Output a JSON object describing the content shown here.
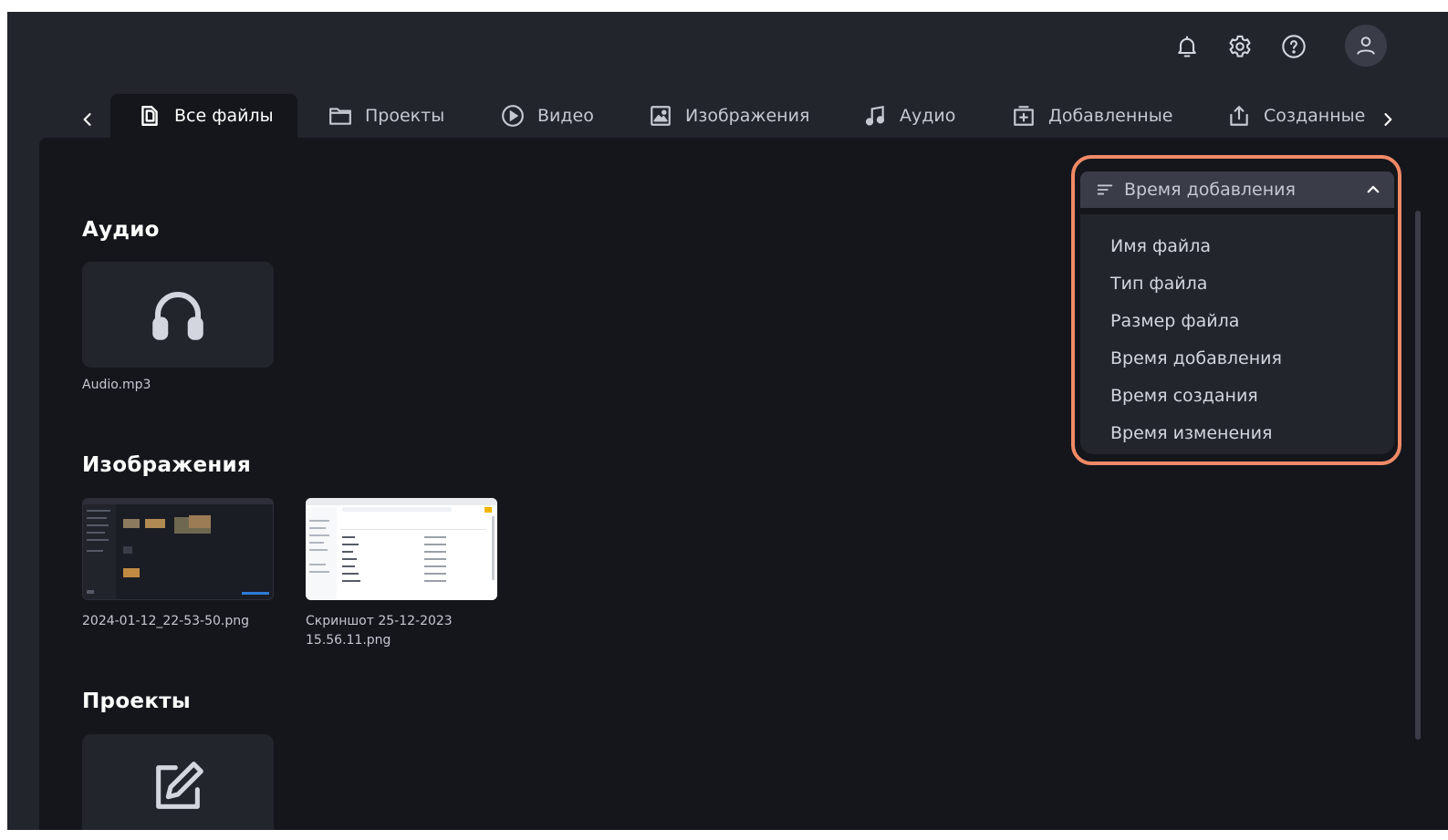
{
  "header": {
    "icons": [
      "bell-icon",
      "gear-icon",
      "help-icon",
      "user-icon"
    ]
  },
  "tabs": [
    {
      "label": "Все файлы",
      "icon": "files-icon",
      "active": true
    },
    {
      "label": "Проекты",
      "icon": "folder-icon",
      "active": false
    },
    {
      "label": "Видео",
      "icon": "play-circle-icon",
      "active": false
    },
    {
      "label": "Изображения",
      "icon": "image-icon",
      "active": false
    },
    {
      "label": "Аудио",
      "icon": "music-note-icon",
      "active": false
    },
    {
      "label": "Добавленные",
      "icon": "add-box-icon",
      "active": false
    },
    {
      "label": "Созданные",
      "icon": "share-upload-icon",
      "active": false
    }
  ],
  "sections": {
    "audio": {
      "title": "Аудио",
      "files": [
        {
          "name": "Audio.mp3",
          "icon": "headphones-icon"
        }
      ]
    },
    "images": {
      "title": "Изображения",
      "files": [
        {
          "name": "2024-01-12_22-53-50.png"
        },
        {
          "name_line1": "Скриншот 25-12-2023",
          "name_line2": "15.56.11.png"
        }
      ]
    },
    "projects": {
      "title": "Проекты",
      "files": [
        {
          "icon": "edit-icon"
        }
      ]
    }
  },
  "sort": {
    "selected": "Время добавления",
    "expanded": true,
    "options": [
      "Имя файла",
      "Тип файла",
      "Размер файла",
      "Время добавления",
      "Время создания",
      "Время изменения"
    ]
  },
  "colors": {
    "app_bg": "#23252d",
    "panel_bg": "#14161c",
    "highlight": "#f08a66",
    "text": "#c5c8d1"
  }
}
